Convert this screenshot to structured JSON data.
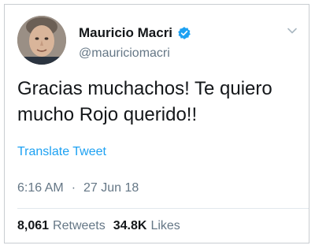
{
  "tweet": {
    "author_name": "Mauricio Macri",
    "author_handle": "@mauriciomacri",
    "verified_icon": "verified-badge-icon",
    "text": "Gracias muchachos! Te quiero mucho Rojo querido!!",
    "translate_label": "Translate Tweet",
    "time": "6:16 AM",
    "separator": "·",
    "date": "27 Jun 18",
    "retweets_count": "8,061",
    "retweets_label": "Retweets",
    "likes_count": "34.8K",
    "likes_label": "Likes"
  },
  "colors": {
    "accent": "#1da1f2",
    "text": "#14171a",
    "muted": "#657786"
  }
}
